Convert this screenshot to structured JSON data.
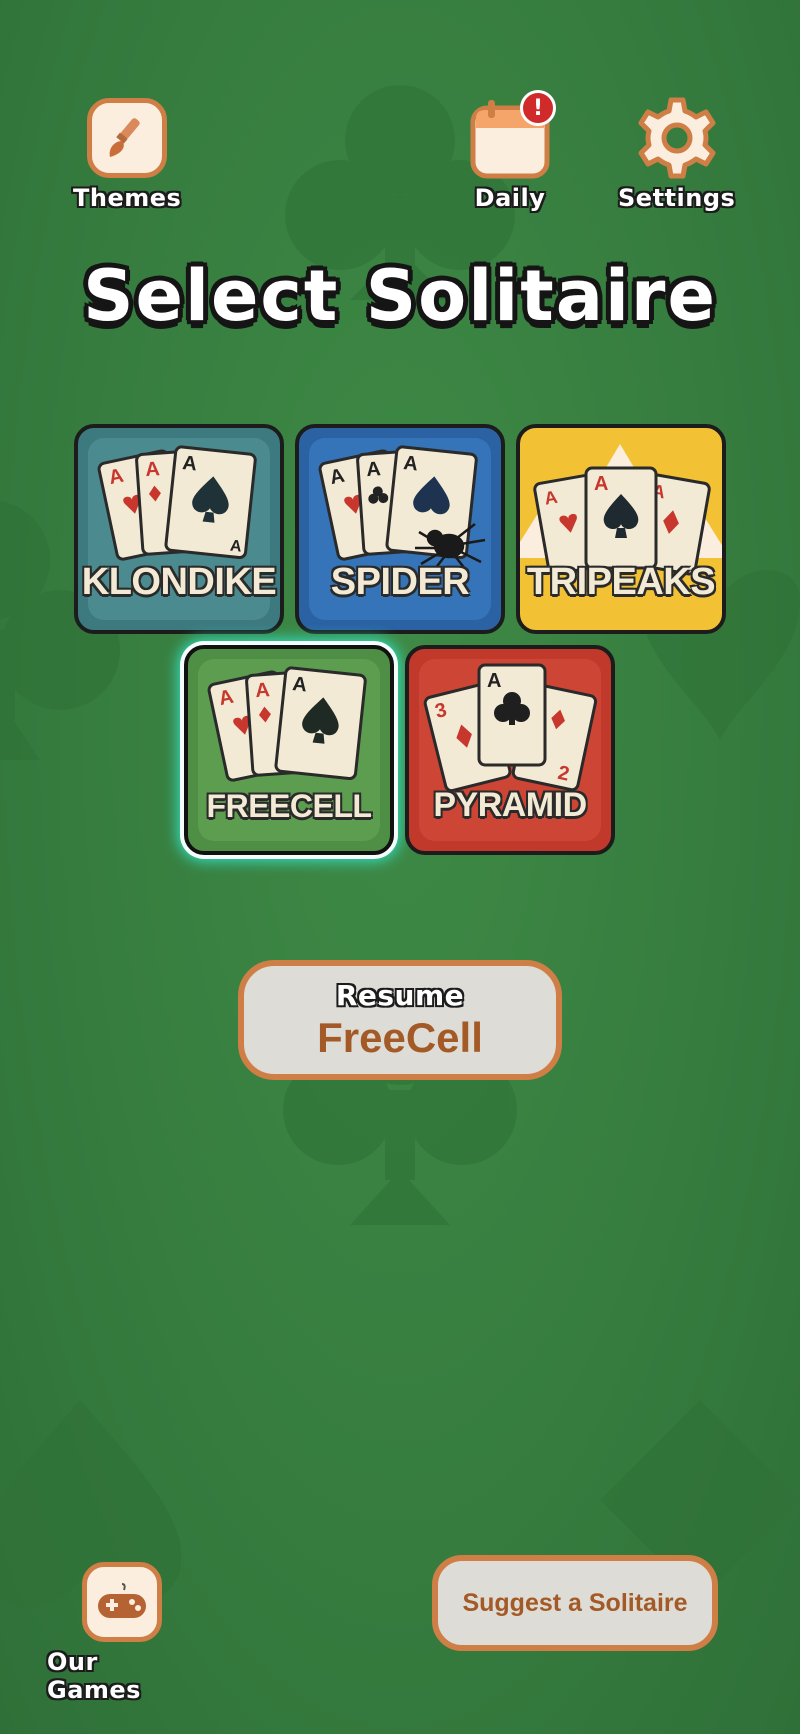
{
  "header": {
    "themes_label": "Themes",
    "daily_label": "Daily",
    "daily_badge": "!",
    "settings_label": "Settings"
  },
  "title": "Select Solitaire",
  "games": [
    {
      "name": "KLONDIKE",
      "color": "#3d7a7f",
      "selected": false
    },
    {
      "name": "SPIDER",
      "color": "#2a62a3",
      "selected": false
    },
    {
      "name": "TRIPEAKS",
      "color": "#f2c234",
      "selected": false
    },
    {
      "name": "FREECELL",
      "color": "#4f8f45",
      "selected": true
    },
    {
      "name": "PYRAMID",
      "color": "#c1392b",
      "selected": false
    }
  ],
  "resume": {
    "label": "Resume",
    "game": "FreeCell"
  },
  "footer": {
    "our_games_label": "Our Games",
    "suggest_label": "Suggest a Solitaire"
  },
  "icons": {
    "themes": "paintbrush-icon",
    "daily": "calendar-icon",
    "settings": "gear-icon",
    "our_games": "gamepad-icon"
  },
  "colors": {
    "felt": "#367d3f",
    "accent": "#cf7e46",
    "selected_glow": "#33e0c2"
  }
}
